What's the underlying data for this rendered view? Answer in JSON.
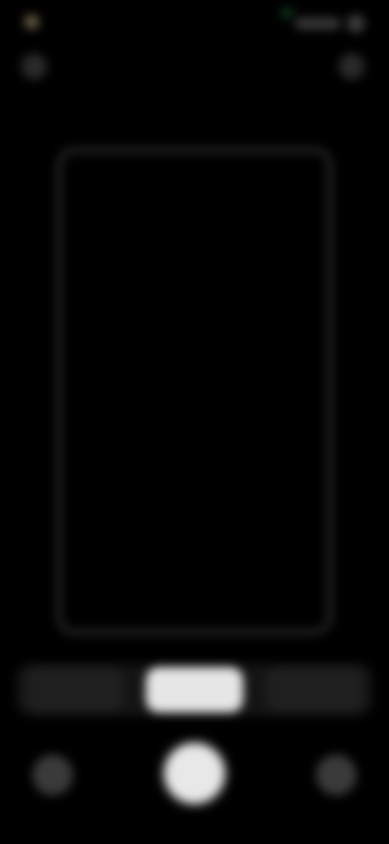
{
  "colors": {
    "background": "#000000",
    "frame": "#2c2c2c",
    "active_mode": "#e6e6e6",
    "inactive_mode": "#1f1f1f"
  },
  "status": {
    "icons": [
      "camera-dot-icon",
      "signal-icon",
      "battery-icon"
    ]
  },
  "top_row": {
    "left_icon": "settings-icon",
    "right_icon": "flash-icon"
  },
  "modes": [
    {
      "label": "",
      "active": false
    },
    {
      "label": "",
      "active": true
    },
    {
      "label": "",
      "active": false
    }
  ],
  "controls": {
    "left": "gallery-icon",
    "center": "shutter-button",
    "right": "switch-camera-icon"
  }
}
